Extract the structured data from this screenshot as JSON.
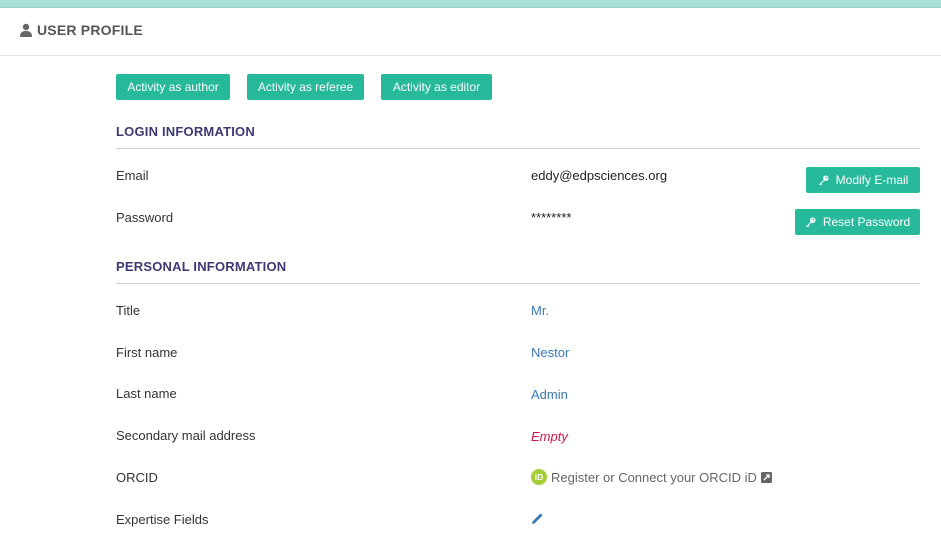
{
  "header": {
    "title": "USER PROFILE",
    "icon": "user-icon"
  },
  "tabs": [
    {
      "label": "Activity as author"
    },
    {
      "label": "Activity as referee"
    },
    {
      "label": "Activity as editor"
    }
  ],
  "login": {
    "section_title": "LOGIN INFORMATION",
    "email_label": "Email",
    "email_value": "eddy@edpsciences.org",
    "modify_email_button": "Modify E-mail",
    "password_label": "Password",
    "password_value": "********",
    "reset_password_button": "Reset Password"
  },
  "personal": {
    "section_title": "PERSONAL INFORMATION",
    "title_label": "Title",
    "title_value": "Mr.",
    "first_name_label": "First name",
    "first_name_value": "Nestor",
    "last_name_label": "Last name",
    "last_name_value": "Admin",
    "secondary_mail_label": "Secondary mail address",
    "secondary_mail_value": "Empty",
    "orcid_label": "ORCID",
    "orcid_link_text": "Register or Connect your ORCID iD",
    "expertise_label": "Expertise Fields"
  },
  "colors": {
    "accent": "#26b99a",
    "section_title": "#3d3a73",
    "link": "#3a78b5",
    "empty": "#d0164f",
    "orcid_green": "#a6ce39"
  }
}
